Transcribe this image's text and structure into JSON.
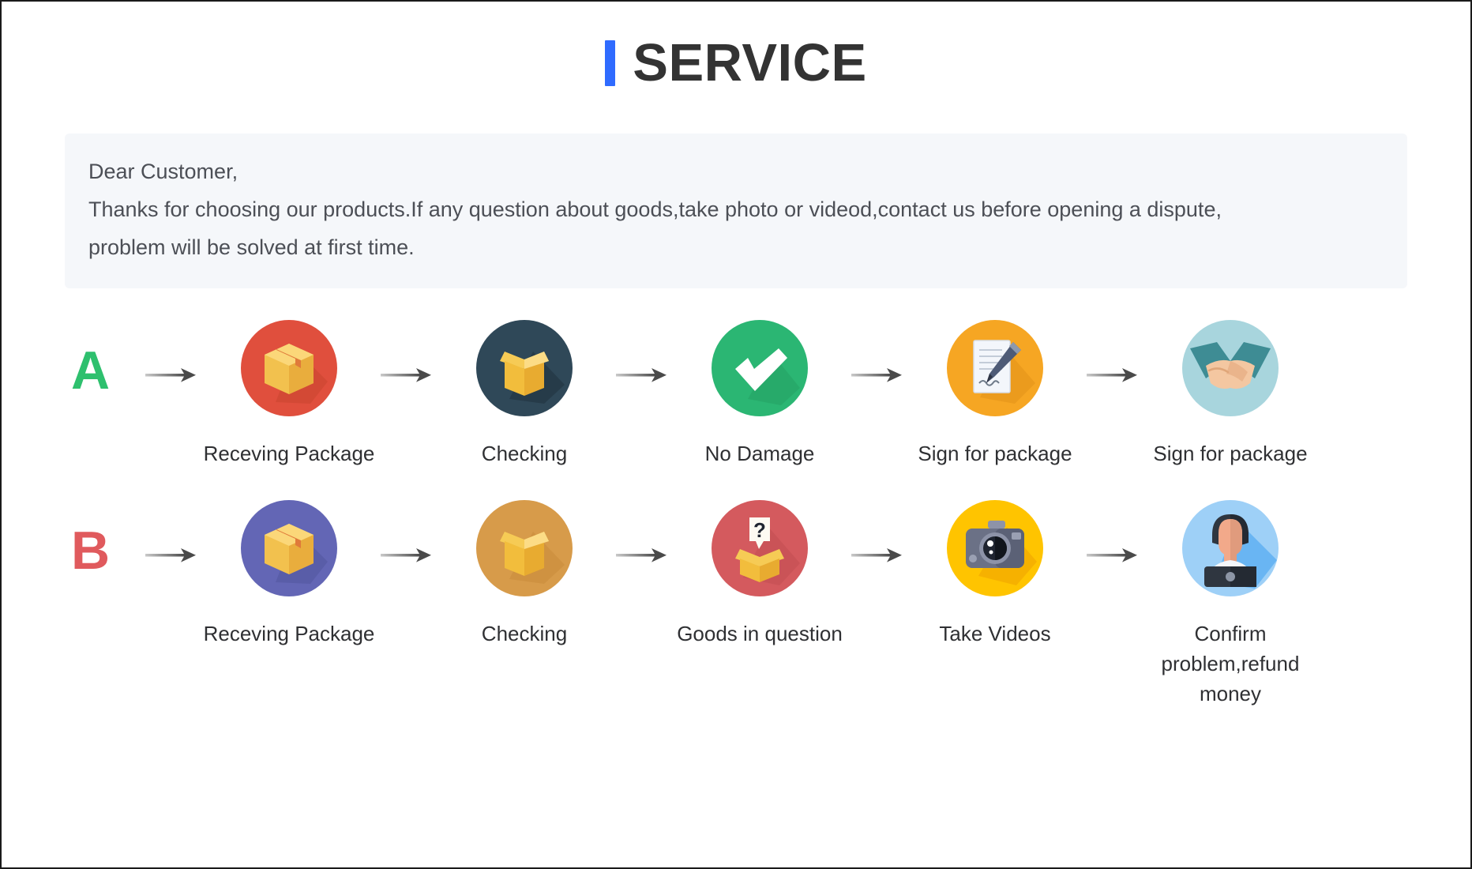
{
  "header": {
    "accent_color": "#2f6bff",
    "title": "SERVICE"
  },
  "notice": {
    "line1": "Dear Customer,",
    "line2": "Thanks for choosing our products.If any question about goods,take photo or videod,contact us before opening a dispute,",
    "line3": "problem will be solved at first time.",
    "background": "#f5f7fa"
  },
  "flows": [
    {
      "letter": "A",
      "letter_color": "#2ec06e",
      "steps": [
        {
          "icon": "package-box-icon",
          "label": "Receving Package",
          "circle_color": "#e04f3d"
        },
        {
          "icon": "open-box-icon",
          "label": "Checking",
          "circle_color": "#2f4858"
        },
        {
          "icon": "check-mark-icon",
          "label": "No Damage",
          "circle_color": "#2bb673"
        },
        {
          "icon": "sign-document-icon",
          "label": "Sign for package",
          "circle_color": "#f6a623"
        },
        {
          "icon": "handshake-icon",
          "label": "Sign for package",
          "circle_color": "#a8d5dd"
        }
      ]
    },
    {
      "letter": "B",
      "letter_color": "#e05a5d",
      "steps": [
        {
          "icon": "package-box-icon",
          "label": "Receving Package",
          "circle_color": "#6366b5"
        },
        {
          "icon": "open-box-icon",
          "label": "Checking",
          "circle_color": "#d79b4a"
        },
        {
          "icon": "question-box-icon",
          "label": "Goods in question",
          "circle_color": "#d45a5e"
        },
        {
          "icon": "camera-icon",
          "label": "Take Videos",
          "circle_color": "#ffc400"
        },
        {
          "icon": "support-agent-icon",
          "label": "Confirm problem,refund money",
          "circle_color": "#9ed0f7"
        }
      ]
    }
  ]
}
